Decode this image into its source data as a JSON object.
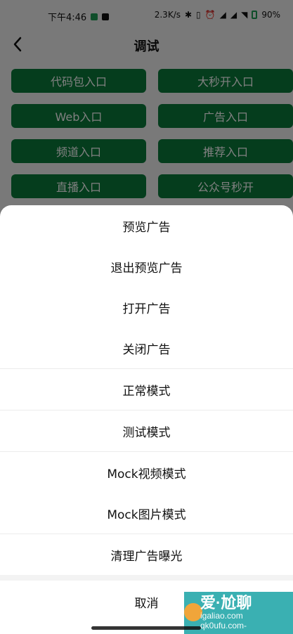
{
  "status_bar": {
    "time": "下午4:46",
    "speed": "2.3K/s",
    "battery": "90",
    "battery_suffix": "%"
  },
  "nav": {
    "title": "调试"
  },
  "grid": {
    "buttons": [
      {
        "label": "代码包入口"
      },
      {
        "label": "大秒开入口"
      },
      {
        "label": "Web入口"
      },
      {
        "label": "广告入口"
      },
      {
        "label": "频道入口"
      },
      {
        "label": "推荐入口"
      },
      {
        "label": "直播入口"
      },
      {
        "label": "公众号秒开"
      }
    ]
  },
  "sheet": {
    "items": [
      {
        "label": "预览广告"
      },
      {
        "label": "退出预览广告"
      },
      {
        "label": "打开广告"
      },
      {
        "label": "关闭广告"
      },
      {
        "label": "正常模式"
      },
      {
        "label": "测试模式"
      },
      {
        "label": "Mock视频模式"
      },
      {
        "label": "Mock图片模式"
      },
      {
        "label": "清理广告曝光"
      }
    ],
    "cancel": "取消"
  },
  "watermark": {
    "line1": "爱·尬聊",
    "line2": "igaliao.com",
    "line3": "qk0ufu.com-"
  },
  "colors": {
    "accent_green": "#0b7a3b",
    "watermark_teal": "#17a2a5"
  }
}
